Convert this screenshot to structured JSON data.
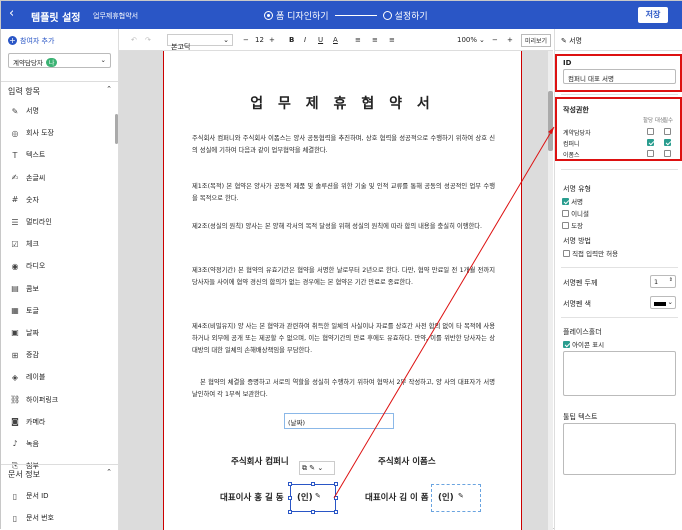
{
  "header": {
    "title": "템플릿 설정",
    "doc_name": "업무제휴협약서",
    "step1": "폼 디자인하기",
    "step2": "설정하기",
    "save_label": "저장"
  },
  "left": {
    "add_user": "참여자 추가",
    "participant": "계약담당자",
    "participant_badge": "나",
    "input_section": "입력 항목",
    "items": [
      {
        "icon": "✎",
        "label": "서명"
      },
      {
        "icon": "◎",
        "label": "회사 도장"
      },
      {
        "icon": "T",
        "label": "텍스트"
      },
      {
        "icon": "✍",
        "label": "손글씨"
      },
      {
        "icon": "#",
        "label": "숫자"
      },
      {
        "icon": "☰",
        "label": "멀티라인"
      },
      {
        "icon": "☑",
        "label": "체크"
      },
      {
        "icon": "◉",
        "label": "라디오"
      },
      {
        "icon": "▤",
        "label": "콤보"
      },
      {
        "icon": "▦",
        "label": "토글"
      },
      {
        "icon": "▣",
        "label": "날짜"
      },
      {
        "icon": "⊞",
        "label": "증감"
      },
      {
        "icon": "◈",
        "label": "레이블"
      },
      {
        "icon": "⛓",
        "label": "하이퍼링크"
      },
      {
        "icon": "◙",
        "label": "카메라"
      },
      {
        "icon": "♪",
        "label": "녹음"
      },
      {
        "icon": "⎘",
        "label": "첨부"
      }
    ],
    "doc_section": "문서 정보",
    "doc_items": [
      {
        "icon": "▯",
        "label": "문서 ID"
      },
      {
        "icon": "▯",
        "label": "문서 번호"
      }
    ]
  },
  "toolbar": {
    "font": "본고딕",
    "size": "12",
    "zoom": "100%",
    "preview": "미리보기"
  },
  "document": {
    "title": "업 무 제 휴 협 약 서",
    "paragraphs": [
      "주식회사 컴퍼니와 주식회사 이폼스는 양사 공동협력을 추진하며, 상호 협력을 성공적으로 수행하기 위하여 상호 신의 성실에 기하여 다음과 같이 업무협약을 체결한다.",
      "제1조(목적) 본 협약은 양사가 공동적 제품 및 솔루션을 위한 기술 및 인적 교류를 통해 공동의 성공적인 업무 수행을 목적으로 한다.",
      "제2조(성실의 원칙) 양사는 본 양해 각서의 목적 달성을 위해 성실의 원칙에 따라 합의 내용을 충실히 이행한다.",
      "제3조(약정기간) 본 협약의 유효기간은 협약을 서명한 날로부터 2년으로 한다. 다만, 협약 만료일 전 1개월 전까지 당사자들 사이에 협약 경신의 합의가 없는 경우에는 본 협약은 기간 만료로 종료한다.",
      "제4조(비밀유지) 양 사는 본 협약과 관련하여 취득한 일체의 사실이나 자료를 상호간 사전 합의 없이 타 목적에 사용하거나 외부에 공개 또는 제공할 수 없으며, 이는 협약기간의 만료 후에도 유효하다. 만약, 이를 위반한 당사자는 상대방의 대한 일체의 손해배상책임을 부담한다.",
      "본 협약의 체결을 증명하고 서로의 역할을 성실히 수행하기 위하여 협약서 2부 작성하고, 양 사의 대표자가 서명 날인하여 각 1부씩 보관한다."
    ],
    "date_field": "(날짜)",
    "company_a": "주식회사 컴퍼니",
    "company_b": "주식회사 이폼스",
    "rep_a": "대표이사  홍 길 동",
    "rep_b": "대표이사 김 이 폼",
    "seal": "(인)"
  },
  "right": {
    "header": "서명",
    "id_label": "ID",
    "id_value": "컴퍼니 대표 서명",
    "perm_label": "작성권한",
    "perm_col1": "할당 대상",
    "perm_col2": "필수",
    "perm_rows": [
      {
        "name": "계약담당자",
        "assigned": false,
        "required": false
      },
      {
        "name": "컴퍼니",
        "assigned": true,
        "required": true
      },
      {
        "name": "이폼스",
        "assigned": false,
        "required": false
      }
    ],
    "sign_type_label": "서명 유형",
    "sign_types": [
      {
        "label": "서명",
        "on": true
      },
      {
        "label": "이니셜",
        "on": false
      },
      {
        "label": "도장",
        "on": false
      }
    ],
    "sign_method_label": "서명 방법",
    "direct_input": "직접 입력만 허용",
    "pen_width_label": "서명펜 두께",
    "pen_width": "1",
    "pen_color_label": "서명펜 색",
    "placeholder_label": "플레이스홀더",
    "show_icon": "아이콘 표시",
    "tooltip_label": "툴팁 텍스트",
    "accent": "#2a56c6",
    "highlight": "#dd1111"
  }
}
